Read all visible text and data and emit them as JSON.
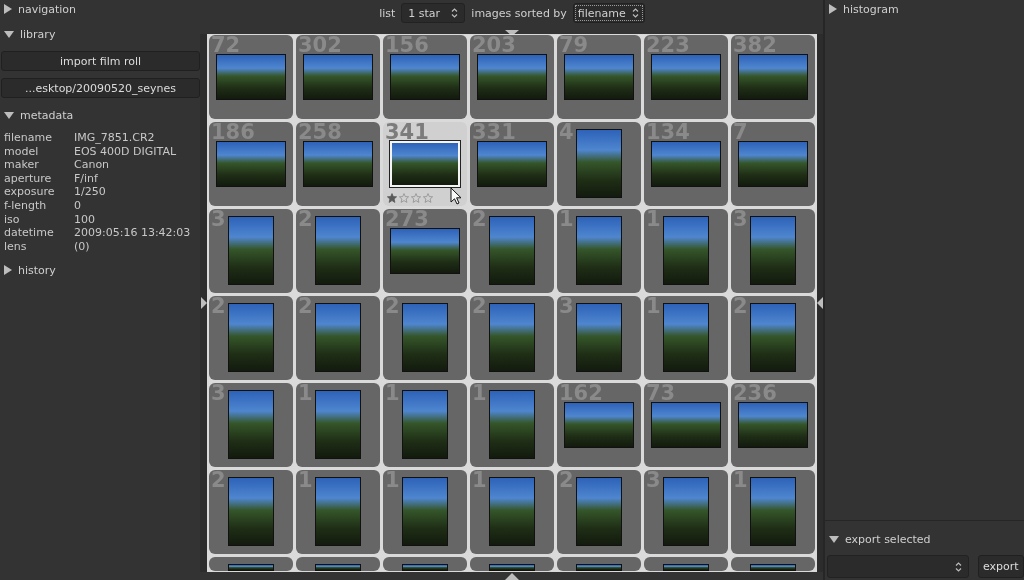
{
  "top_bar": {
    "list_label": "list",
    "filter": {
      "value": "1 star"
    },
    "sort_label": "images sorted by",
    "sort": {
      "value": "filename",
      "focused": true
    }
  },
  "left_panel": {
    "sections": [
      {
        "title": "navigation",
        "expanded": false
      },
      {
        "kind": "buttons",
        "title": "library",
        "expanded": true,
        "buttons": [
          "import film roll",
          "...esktop/20090520_seynes"
        ]
      },
      {
        "kind": "metadata",
        "title": "metadata",
        "expanded": true,
        "fields": [
          {
            "label": "filename",
            "value": "IMG_7851.CR2"
          },
          {
            "label": "model",
            "value": "EOS 400D DIGITAL"
          },
          {
            "label": "maker",
            "value": "Canon"
          },
          {
            "label": "aperture",
            "value": "F/inf"
          },
          {
            "label": "exposure",
            "value": "1/250"
          },
          {
            "label": "f-length",
            "value": "0"
          },
          {
            "label": "iso",
            "value": "100"
          },
          {
            "label": "datetime",
            "value": "2009:05:16 13:42:03"
          },
          {
            "label": "lens",
            "value": "(0)"
          }
        ]
      },
      {
        "title": "history",
        "expanded": false
      }
    ]
  },
  "thumbnails": [
    {
      "number": "72",
      "kind": "landscape",
      "selected": false
    },
    {
      "number": "302",
      "kind": "landscape",
      "selected": false
    },
    {
      "number": "156",
      "kind": "landscape",
      "selected": false
    },
    {
      "number": "203",
      "kind": "landscape",
      "selected": false
    },
    {
      "number": "79",
      "kind": "landscape",
      "selected": false
    },
    {
      "number": "223",
      "kind": "landscape",
      "selected": false
    },
    {
      "number": "382",
      "kind": "landscape",
      "selected": false
    },
    {
      "number": "186",
      "kind": "landscape",
      "selected": false
    },
    {
      "number": "258",
      "kind": "landscape",
      "selected": false
    },
    {
      "number": "341",
      "kind": "landscape",
      "selected": true,
      "stars": 1
    },
    {
      "number": "331",
      "kind": "landscape",
      "selected": false
    },
    {
      "number": "4",
      "kind": "portrait",
      "selected": false
    },
    {
      "number": "134",
      "kind": "landscape",
      "selected": false
    },
    {
      "number": "7",
      "kind": "landscape",
      "selected": false
    },
    {
      "number": "3",
      "kind": "portrait",
      "selected": false
    },
    {
      "number": "2",
      "kind": "portrait",
      "selected": false
    },
    {
      "number": "273",
      "kind": "landscape",
      "selected": false
    },
    {
      "number": "2",
      "kind": "portrait",
      "selected": false
    },
    {
      "number": "1",
      "kind": "portrait",
      "selected": false
    },
    {
      "number": "1",
      "kind": "portrait",
      "selected": false
    },
    {
      "number": "3",
      "kind": "portrait",
      "selected": false
    },
    {
      "number": "2",
      "kind": "portrait",
      "selected": false
    },
    {
      "number": "2",
      "kind": "portrait",
      "selected": false
    },
    {
      "number": "2",
      "kind": "portrait",
      "selected": false
    },
    {
      "number": "2",
      "kind": "portrait",
      "selected": false
    },
    {
      "number": "3",
      "kind": "portrait",
      "selected": false
    },
    {
      "number": "1",
      "kind": "portrait",
      "selected": false
    },
    {
      "number": "2",
      "kind": "portrait",
      "selected": false
    },
    {
      "number": "3",
      "kind": "portrait",
      "selected": false
    },
    {
      "number": "1",
      "kind": "portrait",
      "selected": false
    },
    {
      "number": "1",
      "kind": "portrait",
      "selected": false
    },
    {
      "number": "1",
      "kind": "portrait",
      "selected": false
    },
    {
      "number": "162",
      "kind": "landscape",
      "selected": false
    },
    {
      "number": "73",
      "kind": "landscape",
      "selected": false
    },
    {
      "number": "236",
      "kind": "landscape",
      "selected": false
    },
    {
      "number": "2",
      "kind": "portrait",
      "selected": false
    },
    {
      "number": "1",
      "kind": "portrait",
      "selected": false
    },
    {
      "number": "1",
      "kind": "portrait",
      "selected": false
    },
    {
      "number": "1",
      "kind": "portrait",
      "selected": false
    },
    {
      "number": "2",
      "kind": "portrait",
      "selected": false
    },
    {
      "number": "3",
      "kind": "portrait",
      "selected": false
    },
    {
      "number": "1",
      "kind": "portrait",
      "selected": false
    },
    {
      "kind": "portrait",
      "selected": false
    },
    {
      "kind": "portrait",
      "selected": false
    },
    {
      "kind": "portrait",
      "selected": false
    },
    {
      "kind": "portrait",
      "selected": false
    },
    {
      "kind": "portrait",
      "selected": false
    },
    {
      "kind": "portrait",
      "selected": false
    },
    {
      "kind": "portrait",
      "selected": false
    }
  ],
  "right_panel": {
    "histogram": {
      "title": "histogram",
      "expanded": false
    },
    "export": {
      "title": "export selected",
      "expanded": true,
      "button": "export"
    }
  }
}
